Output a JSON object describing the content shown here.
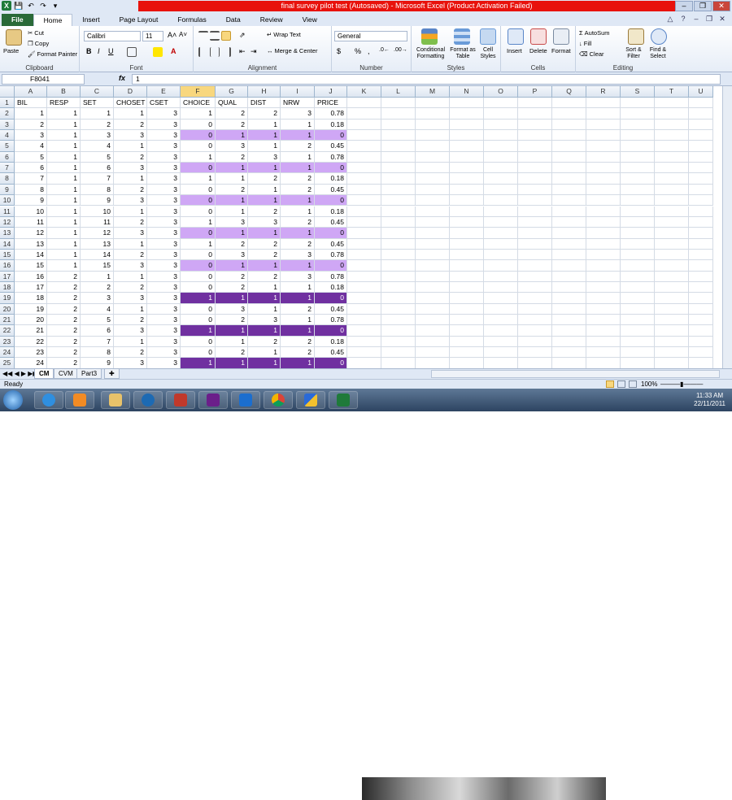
{
  "window": {
    "title": "final survey pilot test (Autosaved) - Microsoft Excel (Product Activation Failed)"
  },
  "tabs": [
    "File",
    "Home",
    "Insert",
    "Page Layout",
    "Formulas",
    "Data",
    "Review",
    "View"
  ],
  "ribbon": {
    "clipboard": {
      "paste": "Paste",
      "cut": "Cut",
      "copy": "Copy",
      "format_painter": "Format Painter",
      "label": "Clipboard"
    },
    "font": {
      "name": "Calibri",
      "size": "11",
      "label": "Font"
    },
    "alignment": {
      "wrap": "Wrap Text",
      "merge": "Merge & Center",
      "label": "Alignment"
    },
    "number": {
      "format": "General",
      "label": "Number"
    },
    "styles": {
      "conditional": "Conditional Formatting",
      "table": "Format as Table",
      "cell": "Cell Styles",
      "label": "Styles"
    },
    "cells": {
      "insert": "Insert",
      "delete": "Delete",
      "format": "Format",
      "label": "Cells"
    },
    "editing": {
      "autosum": "AutoSum",
      "fill": "Fill",
      "clear": "Clear",
      "sort": "Sort & Filter",
      "find": "Find & Select",
      "label": "Editing"
    }
  },
  "formula_bar": {
    "namebox": "F8041",
    "fx": "fx",
    "value": "1"
  },
  "columns": [
    "A",
    "B",
    "C",
    "D",
    "E",
    "F",
    "G",
    "H",
    "I",
    "J",
    "K",
    "L",
    "M",
    "N",
    "O",
    "P",
    "Q",
    "R",
    "S",
    "T",
    "U"
  ],
  "headers": [
    "BIL",
    "RESP",
    "SET",
    "CHOSET",
    "CSET",
    "CHOICE",
    "QUAL",
    "DIST",
    "NRW",
    "PRICE"
  ],
  "rows": [
    {
      "r": "2",
      "v": [
        "1",
        "1",
        "1",
        "1",
        "3",
        "1",
        "2",
        "2",
        "3",
        "0.78"
      ],
      "h": ""
    },
    {
      "r": "3",
      "v": [
        "2",
        "1",
        "2",
        "2",
        "3",
        "0",
        "2",
        "1",
        "1",
        "0.18"
      ],
      "h": ""
    },
    {
      "r": "4",
      "v": [
        "3",
        "1",
        "3",
        "3",
        "3",
        "0",
        "1",
        "1",
        "1",
        "0"
      ],
      "h": "light"
    },
    {
      "r": "5",
      "v": [
        "4",
        "1",
        "4",
        "1",
        "3",
        "0",
        "3",
        "1",
        "2",
        "0.45"
      ],
      "h": ""
    },
    {
      "r": "6",
      "v": [
        "5",
        "1",
        "5",
        "2",
        "3",
        "1",
        "2",
        "3",
        "1",
        "0.78"
      ],
      "h": ""
    },
    {
      "r": "7",
      "v": [
        "6",
        "1",
        "6",
        "3",
        "3",
        "0",
        "1",
        "1",
        "1",
        "0"
      ],
      "h": "light"
    },
    {
      "r": "8",
      "v": [
        "7",
        "1",
        "7",
        "1",
        "3",
        "1",
        "1",
        "2",
        "2",
        "0.18"
      ],
      "h": ""
    },
    {
      "r": "9",
      "v": [
        "8",
        "1",
        "8",
        "2",
        "3",
        "0",
        "2",
        "1",
        "2",
        "0.45"
      ],
      "h": ""
    },
    {
      "r": "10",
      "v": [
        "9",
        "1",
        "9",
        "3",
        "3",
        "0",
        "1",
        "1",
        "1",
        "0"
      ],
      "h": "light"
    },
    {
      "r": "11",
      "v": [
        "10",
        "1",
        "10",
        "1",
        "3",
        "0",
        "1",
        "2",
        "1",
        "0.18"
      ],
      "h": ""
    },
    {
      "r": "12",
      "v": [
        "11",
        "1",
        "11",
        "2",
        "3",
        "1",
        "3",
        "3",
        "2",
        "0.45"
      ],
      "h": ""
    },
    {
      "r": "13",
      "v": [
        "12",
        "1",
        "12",
        "3",
        "3",
        "0",
        "1",
        "1",
        "1",
        "0"
      ],
      "h": "light"
    },
    {
      "r": "14",
      "v": [
        "13",
        "1",
        "13",
        "1",
        "3",
        "1",
        "2",
        "2",
        "2",
        "0.45"
      ],
      "h": ""
    },
    {
      "r": "15",
      "v": [
        "14",
        "1",
        "14",
        "2",
        "3",
        "0",
        "3",
        "2",
        "3",
        "0.78"
      ],
      "h": ""
    },
    {
      "r": "16",
      "v": [
        "15",
        "1",
        "15",
        "3",
        "3",
        "0",
        "1",
        "1",
        "1",
        "0"
      ],
      "h": "light"
    },
    {
      "r": "17",
      "v": [
        "16",
        "2",
        "1",
        "1",
        "3",
        "0",
        "2",
        "2",
        "3",
        "0.78"
      ],
      "h": ""
    },
    {
      "r": "18",
      "v": [
        "17",
        "2",
        "2",
        "2",
        "3",
        "0",
        "2",
        "1",
        "1",
        "0.18"
      ],
      "h": ""
    },
    {
      "r": "19",
      "v": [
        "18",
        "2",
        "3",
        "3",
        "3",
        "1",
        "1",
        "1",
        "1",
        "0"
      ],
      "h": "dark"
    },
    {
      "r": "20",
      "v": [
        "19",
        "2",
        "4",
        "1",
        "3",
        "0",
        "3",
        "1",
        "2",
        "0.45"
      ],
      "h": ""
    },
    {
      "r": "21",
      "v": [
        "20",
        "2",
        "5",
        "2",
        "3",
        "0",
        "2",
        "3",
        "1",
        "0.78"
      ],
      "h": ""
    },
    {
      "r": "22",
      "v": [
        "21",
        "2",
        "6",
        "3",
        "3",
        "1",
        "1",
        "1",
        "1",
        "0"
      ],
      "h": "dark"
    },
    {
      "r": "23",
      "v": [
        "22",
        "2",
        "7",
        "1",
        "3",
        "0",
        "1",
        "2",
        "2",
        "0.18"
      ],
      "h": ""
    },
    {
      "r": "24",
      "v": [
        "23",
        "2",
        "8",
        "2",
        "3",
        "0",
        "2",
        "1",
        "2",
        "0.45"
      ],
      "h": ""
    },
    {
      "r": "25",
      "v": [
        "24",
        "2",
        "9",
        "3",
        "3",
        "1",
        "1",
        "1",
        "1",
        "0"
      ],
      "h": "dark"
    }
  ],
  "sheets": [
    "CM",
    "CVM",
    "Part3"
  ],
  "status": {
    "ready": "Ready",
    "zoom": "100%"
  },
  "clock": {
    "time": "11:33 AM",
    "date": "22/11/2011"
  },
  "colors": {
    "light": "#cfa7f5",
    "dark": "#7030a0",
    "file_tab": "#2a6a38",
    "title_bar": "#e8120c"
  }
}
